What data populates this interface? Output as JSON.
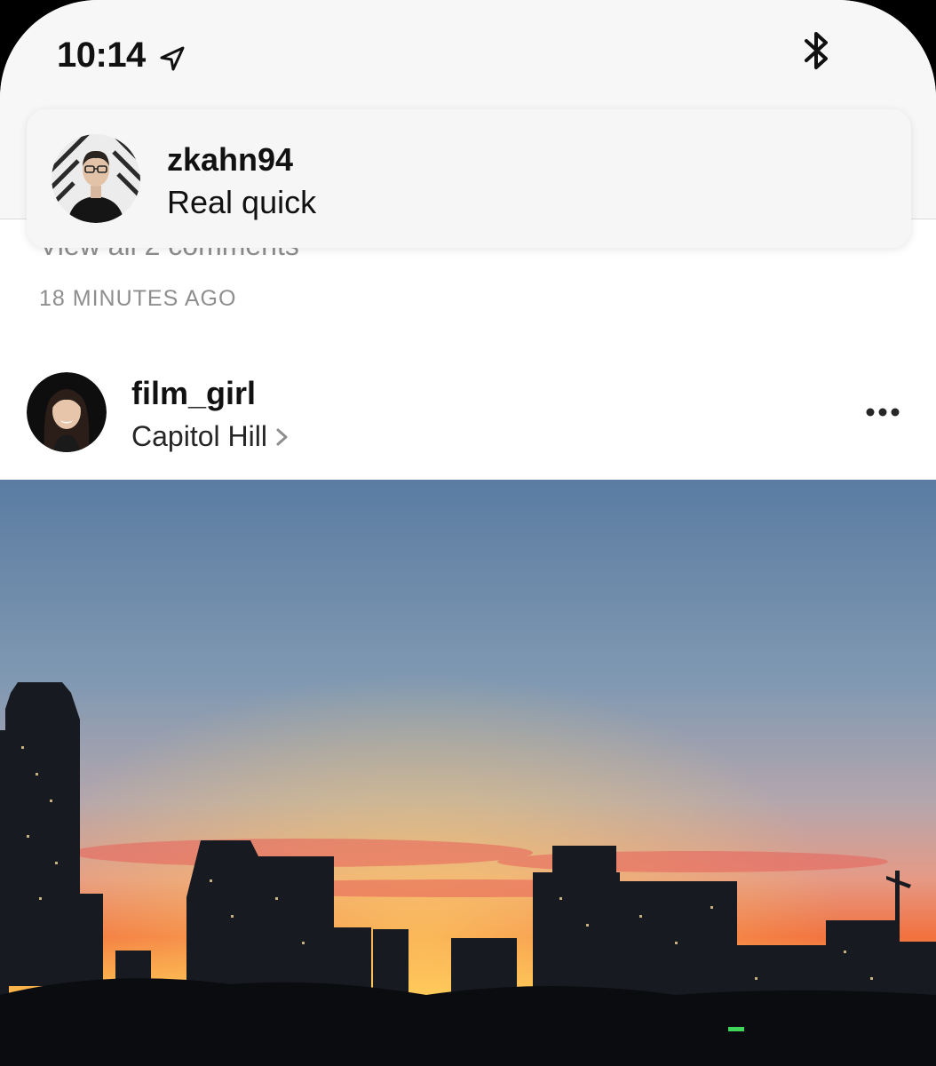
{
  "status_bar": {
    "time": "10:14",
    "location_icon": "location-arrow-icon",
    "bluetooth_icon": "bluetooth-icon"
  },
  "notification": {
    "username": "zkahn94",
    "message": "Real quick"
  },
  "previous_post": {
    "view_comments": "View all 2 comments",
    "timestamp": "18 MINUTES AGO"
  },
  "post": {
    "username": "film_girl",
    "location": "Capitol Hill",
    "more_icon": "more-options-icon"
  },
  "colors": {
    "sky_top": "#5b7ea3",
    "sunset_orange": "#f2713f",
    "sunset_yellow": "#ffd04a",
    "secondary_text": "#8e8e8e"
  }
}
